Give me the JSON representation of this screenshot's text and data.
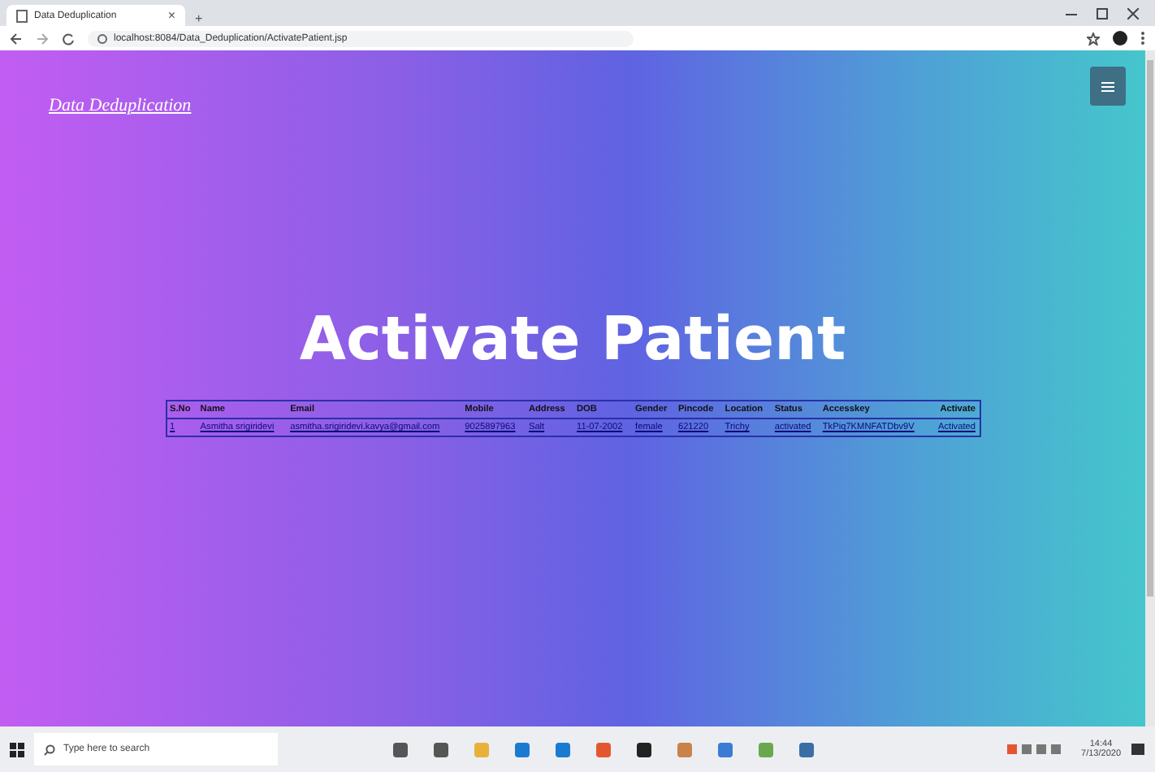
{
  "browser": {
    "tab_title": "Data Deduplication",
    "tab_close": "×",
    "new_tab": "+",
    "url": "localhost:8084/Data_Deduplication/ActivatePatient.jsp"
  },
  "navbar": {
    "brand": "Data Deduplication"
  },
  "heading": "Activate Patient",
  "table": {
    "columns": [
      "S.No",
      "Name",
      "Email",
      "Mobile",
      "Address",
      "DOB",
      "Gender",
      "Pincode",
      "Location",
      "Status",
      "Accesskey",
      "Activate"
    ],
    "rows": [
      [
        "1",
        "Asmitha srigiridevi",
        "asmitha.srigiridevi.kavya@gmail.com",
        "9025897963",
        "Salt",
        "11-07-2002",
        "female",
        "621220",
        "Trichy",
        "activated",
        "TkPiq7KMNFATDbv9V",
        "Activated"
      ]
    ]
  },
  "taskbar": {
    "search_placeholder": "Type here to search",
    "time": "14:44",
    "date": "7/13/2020"
  }
}
